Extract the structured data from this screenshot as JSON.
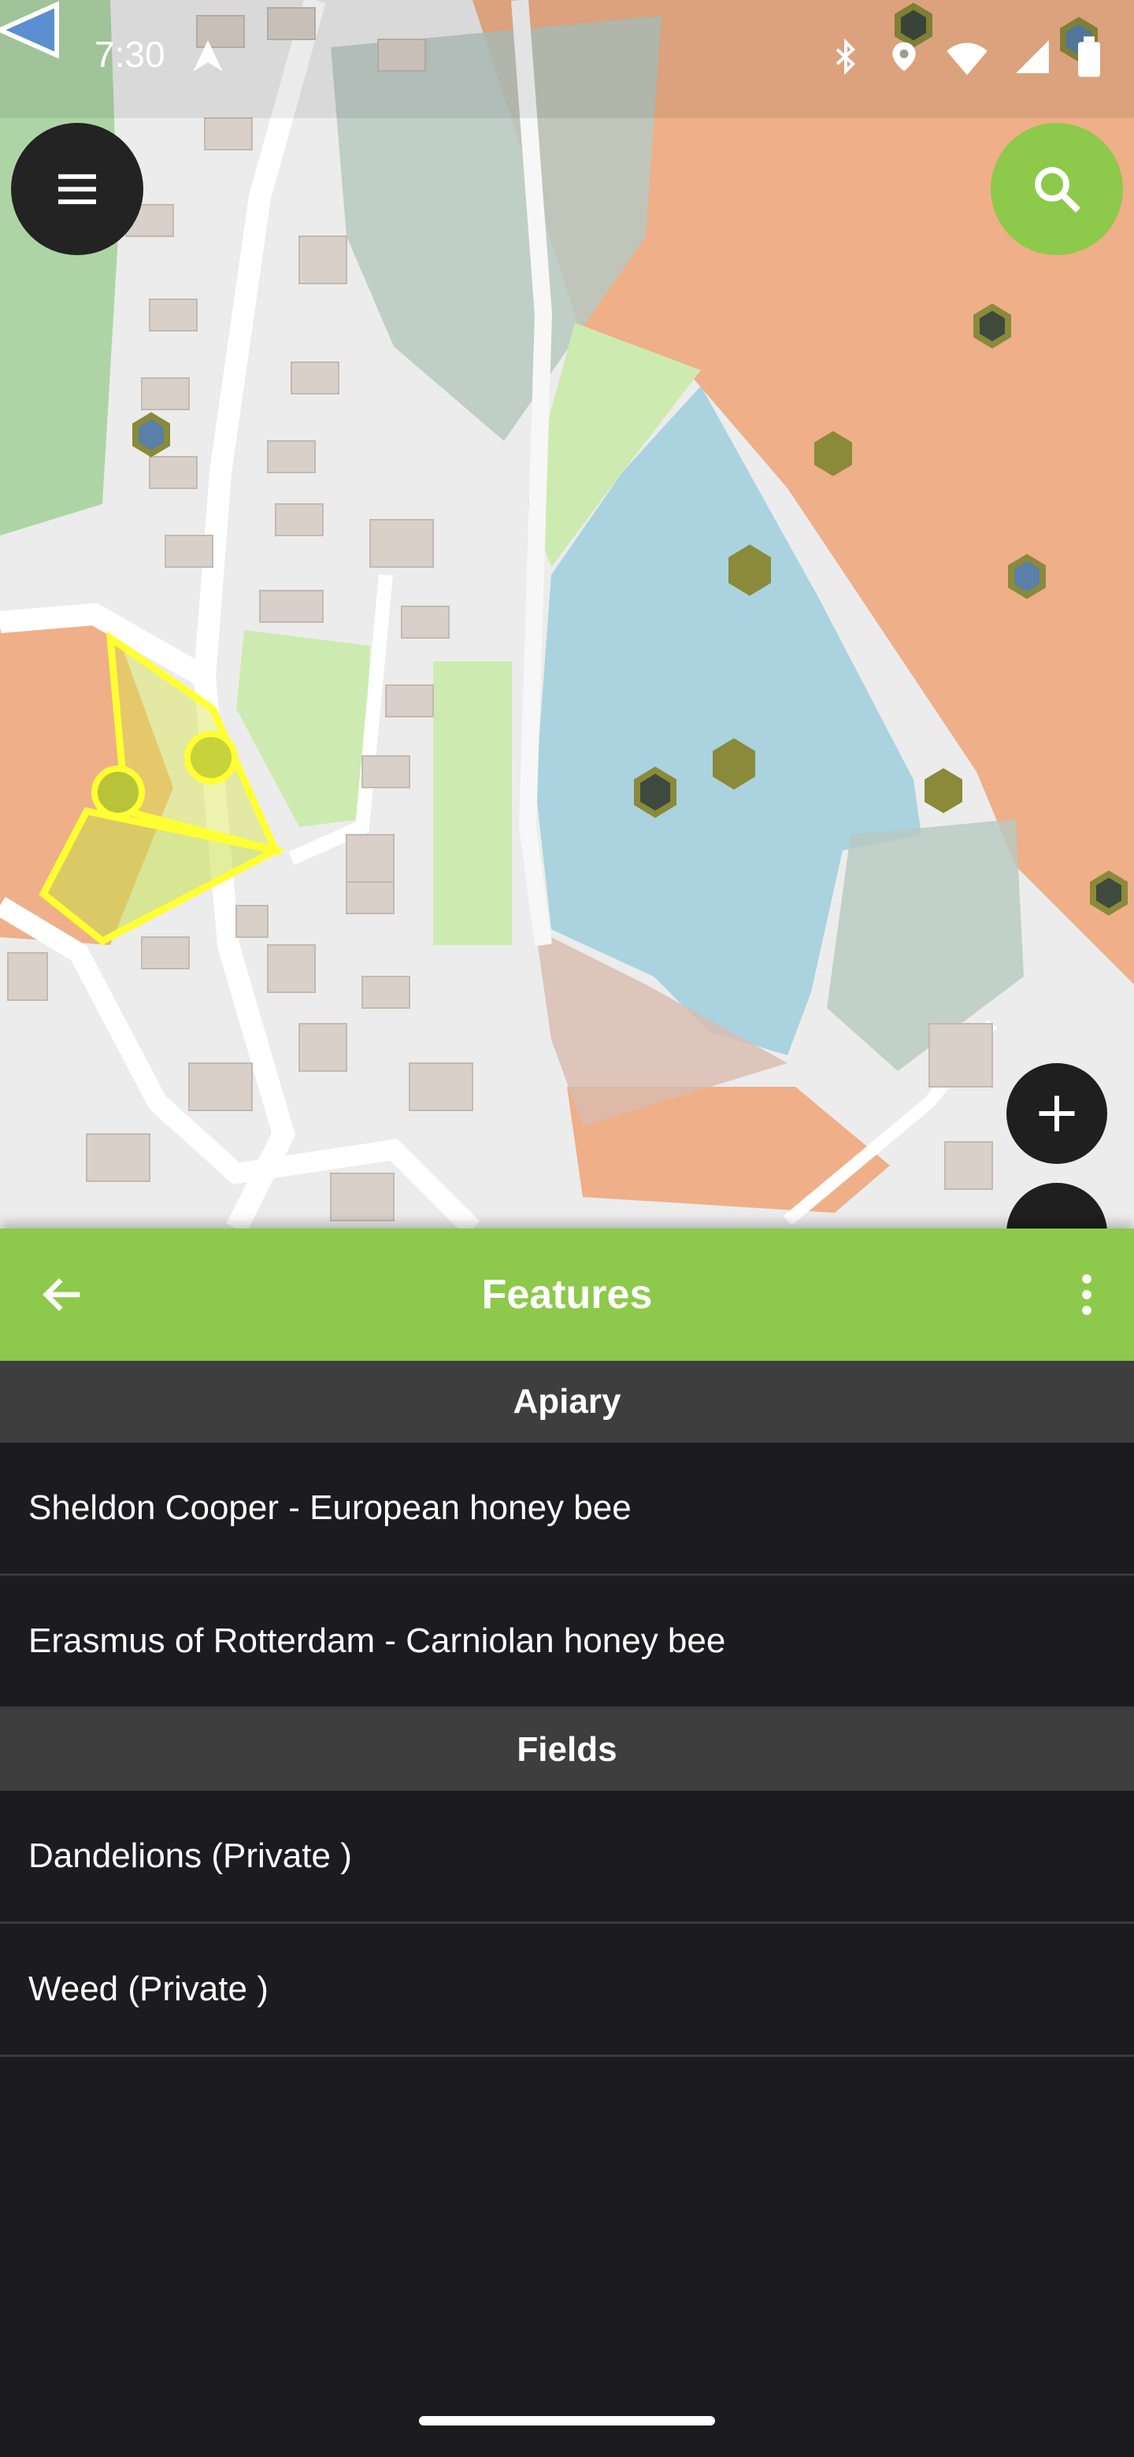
{
  "status_bar": {
    "time": "7:30",
    "icons": [
      "navigation-icon",
      "bluetooth-icon",
      "location-icon",
      "wifi-icon",
      "signal-icon",
      "battery-icon"
    ]
  },
  "map": {
    "controls": [
      "menu-icon",
      "search-icon",
      "add-icon"
    ],
    "colors": {
      "water": "#aad3df",
      "residential_orange": "#f0a477",
      "forest_green": "#a7d19e",
      "meadow": "#cdebb0",
      "selection_yellow": "#ffff33",
      "hive_marker": "#8a8a3a"
    }
  },
  "appbar": {
    "title": "Features",
    "back_icon": "arrow-back-icon",
    "more_icon": "more-vert-icon",
    "color": "#8dc94b"
  },
  "sections": [
    {
      "header": "Apiary",
      "items": [
        "Sheldon Cooper - European honey bee",
        "Erasmus of Rotterdam - Carniolan honey bee"
      ]
    },
    {
      "header": "Fields",
      "items": [
        "Dandelions (Private )",
        "Weed (Private )"
      ]
    }
  ]
}
